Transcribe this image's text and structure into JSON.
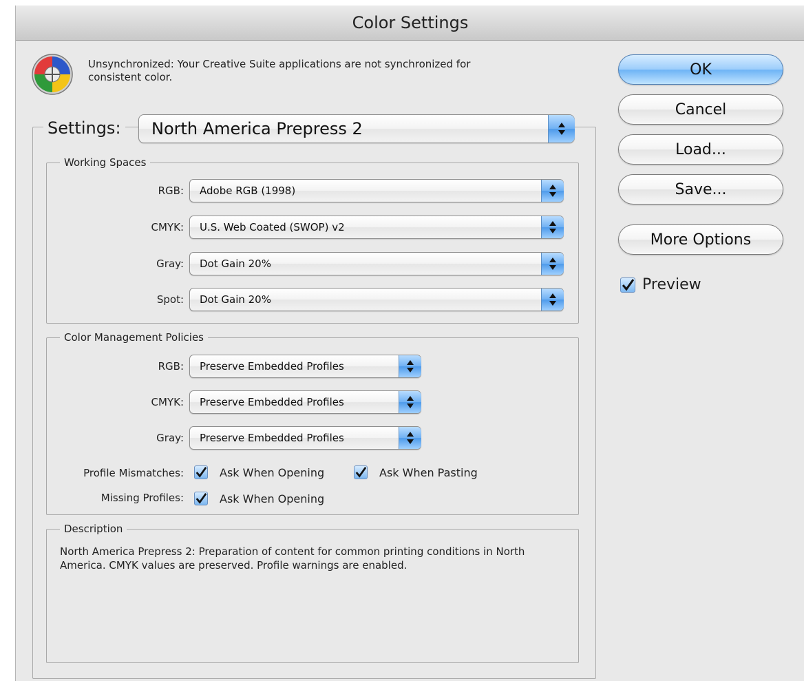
{
  "window": {
    "title": "Color Settings"
  },
  "sync": {
    "icon": "color-wheel-icon",
    "message": "Unsynchronized: Your Creative Suite applications are not synchronized for consistent color."
  },
  "settings": {
    "label": "Settings:",
    "value": "North America Prepress 2"
  },
  "working_spaces": {
    "legend": "Working Spaces",
    "rgb": {
      "label": "RGB:",
      "value": "Adobe RGB (1998)"
    },
    "cmyk": {
      "label": "CMYK:",
      "value": "U.S. Web Coated (SWOP) v2"
    },
    "gray": {
      "label": "Gray:",
      "value": "Dot Gain 20%"
    },
    "spot": {
      "label": "Spot:",
      "value": "Dot Gain 20%"
    }
  },
  "policies": {
    "legend": "Color Management Policies",
    "rgb": {
      "label": "RGB:",
      "value": "Preserve Embedded Profiles"
    },
    "cmyk": {
      "label": "CMYK:",
      "value": "Preserve Embedded Profiles"
    },
    "gray": {
      "label": "Gray:",
      "value": "Preserve Embedded Profiles"
    },
    "profile_mismatches": {
      "label": "Profile Mismatches:",
      "ask_opening": {
        "label": "Ask When Opening",
        "checked": true
      },
      "ask_pasting": {
        "label": "Ask When Pasting",
        "checked": true
      }
    },
    "missing_profiles": {
      "label": "Missing Profiles:",
      "ask_opening": {
        "label": "Ask When Opening",
        "checked": true
      }
    }
  },
  "description": {
    "legend": "Description",
    "text": "North America Prepress 2:  Preparation of content for common printing conditions in North America. CMYK values are preserved. Profile warnings are enabled."
  },
  "buttons": {
    "ok": "OK",
    "cancel": "Cancel",
    "load": "Load...",
    "save": "Save...",
    "more_options": "More Options"
  },
  "preview": {
    "label": "Preview",
    "checked": true
  },
  "colors": {
    "accent": "#6fb0f3",
    "window_bg": "#e9e9e9"
  }
}
